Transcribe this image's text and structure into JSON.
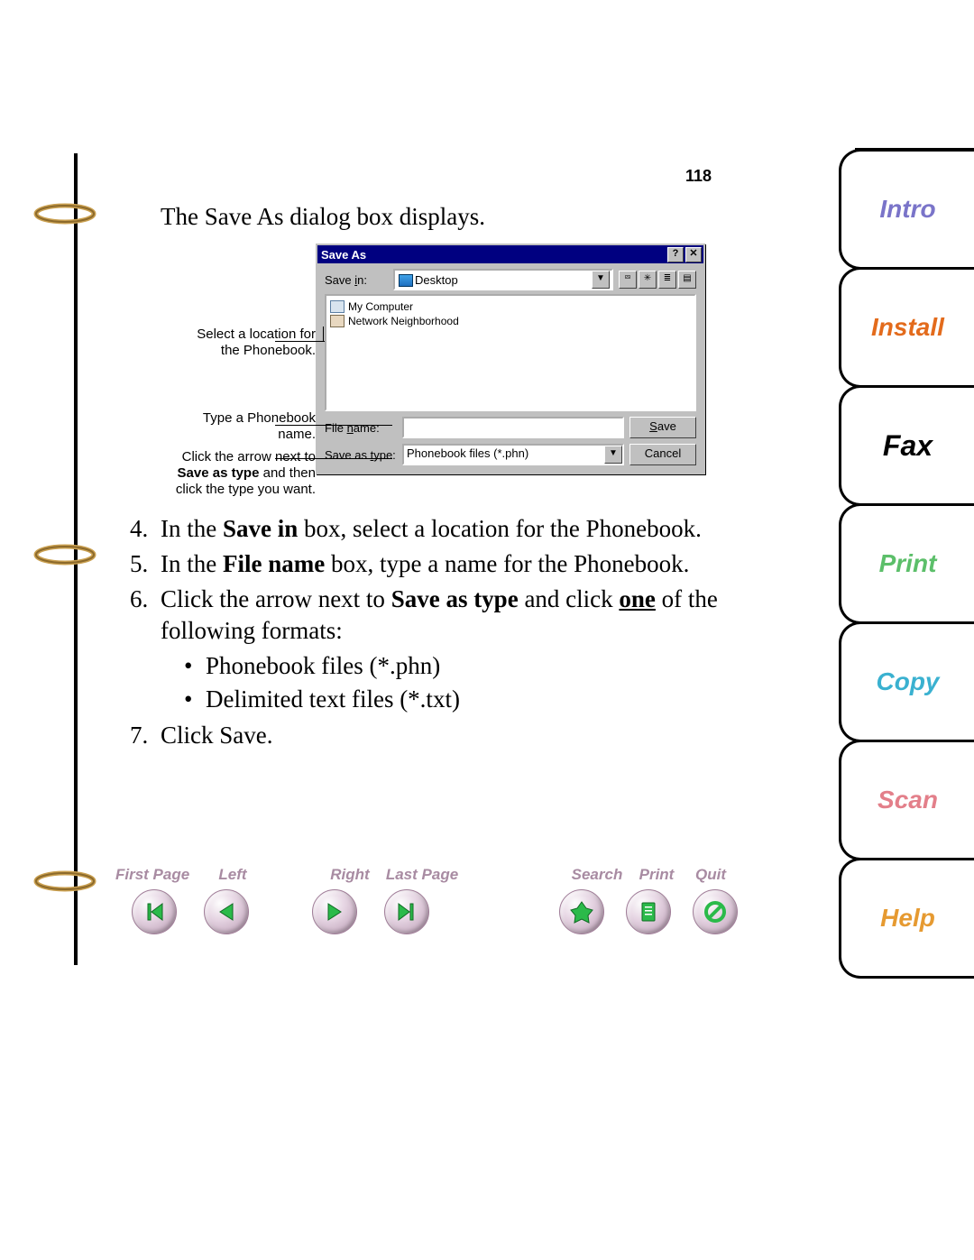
{
  "page_number": "118",
  "intro_text": "The Save As dialog box displays.",
  "dialog": {
    "title": "Save As",
    "help_btn": "?",
    "close_btn": "✕",
    "save_in_label_pre": "Save ",
    "save_in_label_u": "i",
    "save_in_label_post": "n:",
    "save_in_value": "Desktop",
    "list_items": [
      "My Computer",
      "Network Neighborhood"
    ],
    "file_name_label_pre": "File ",
    "file_name_label_u": "n",
    "file_name_label_post": "ame:",
    "file_name_value": "",
    "save_as_type_label_pre": "Save as ",
    "save_as_type_label_u": "t",
    "save_as_type_label_post": "ype:",
    "save_as_type_value": "Phonebook files (*.phn)",
    "save_btn_u": "S",
    "save_btn_rest": "ave",
    "cancel_btn": "Cancel"
  },
  "callouts": {
    "c1a": "Select a location for",
    "c1b": "the Phonebook.",
    "c2a": "Type a Phonebook",
    "c2b": "name.",
    "c3a": "Click the arrow next to",
    "c3b_pre": "",
    "c3b_bold": "Save as type",
    "c3b_post": " and then",
    "c3c": "click the type you want."
  },
  "steps": {
    "s4_pre": "In the ",
    "s4_bold": "Save in",
    "s4_post": " box, select a location for the Phonebook.",
    "s5_pre": "In the ",
    "s5_bold": "File name",
    "s5_post": " box, type a name for the Phonebook.",
    "s6_pre": "Click the arrow next to ",
    "s6_bold": "Save as type",
    "s6_mid": " and click ",
    "s6_und": "one",
    "s6_post": " of the following formats:",
    "s6_b1": "Phonebook files (*.phn)",
    "s6_b2": "Delimited text files (*.txt)",
    "s7": "Click Save."
  },
  "nav": {
    "first": "First Page",
    "left": "Left",
    "right": "Right",
    "last": "Last Page",
    "search": "Search",
    "print": "Print",
    "quit": "Quit"
  },
  "tabs": {
    "intro": "Intro",
    "install": "Install",
    "fax": "Fax",
    "print": "Print",
    "copy": "Copy",
    "scan": "Scan",
    "help": "Help"
  }
}
